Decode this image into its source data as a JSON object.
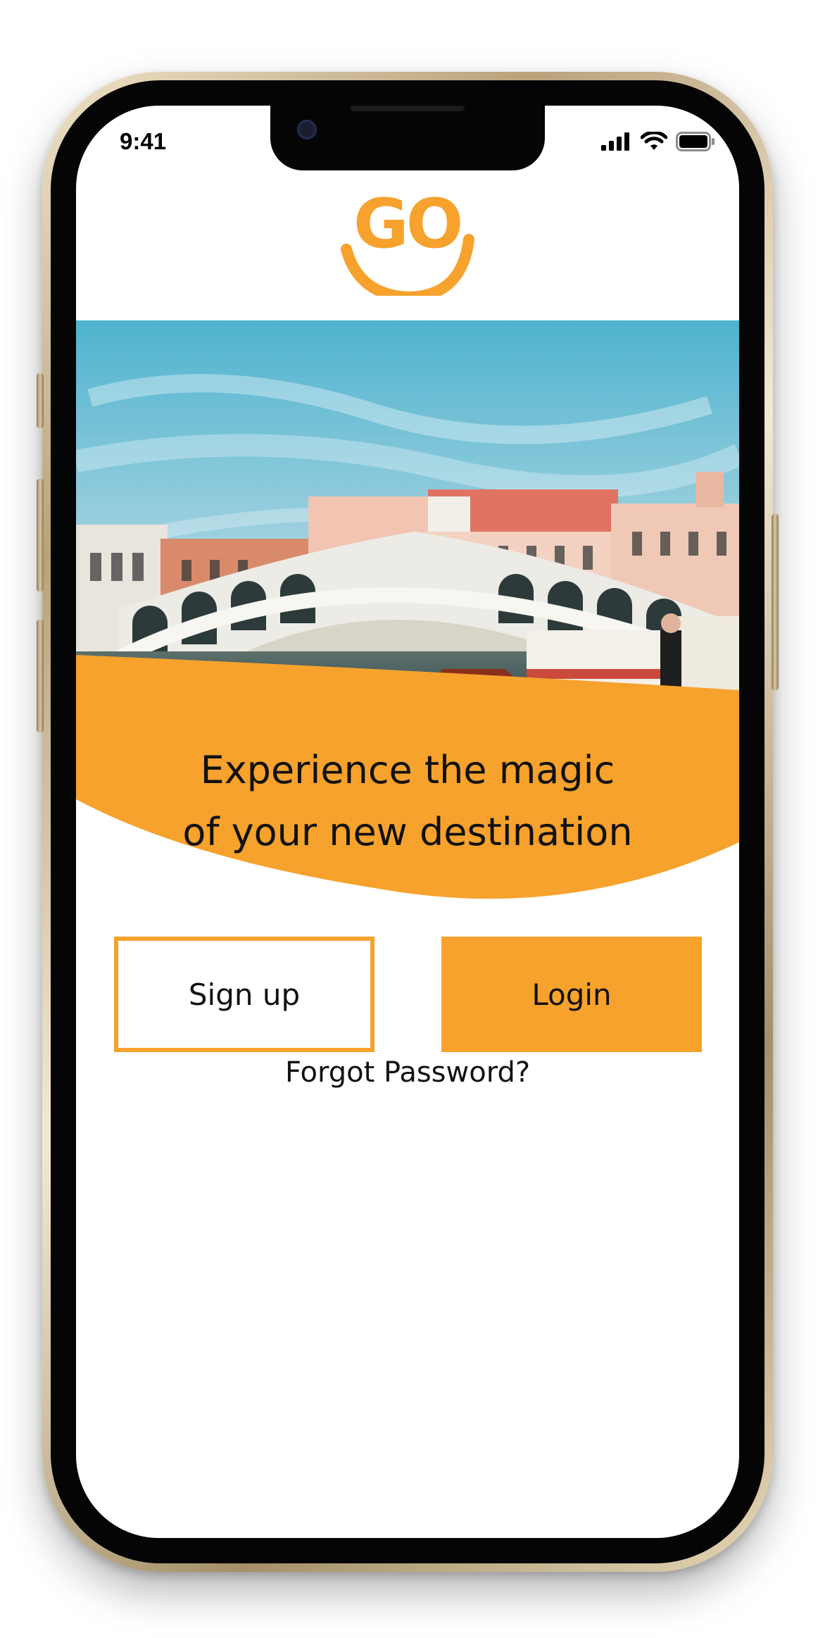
{
  "status_bar": {
    "time": "9:41"
  },
  "brand": {
    "logo_text": "GO",
    "color": "#f6a22d"
  },
  "hero": {
    "image": "venice-rialto-bridge-photo"
  },
  "tagline": {
    "line1": "Experience the magic",
    "line2": "of your new destination"
  },
  "actions": {
    "signup_label": "Sign up",
    "login_label": "Login",
    "forgot_label": "Forgot Password?"
  },
  "colors": {
    "accent": "#f6a22d",
    "text": "#111111",
    "background": "#ffffff"
  }
}
